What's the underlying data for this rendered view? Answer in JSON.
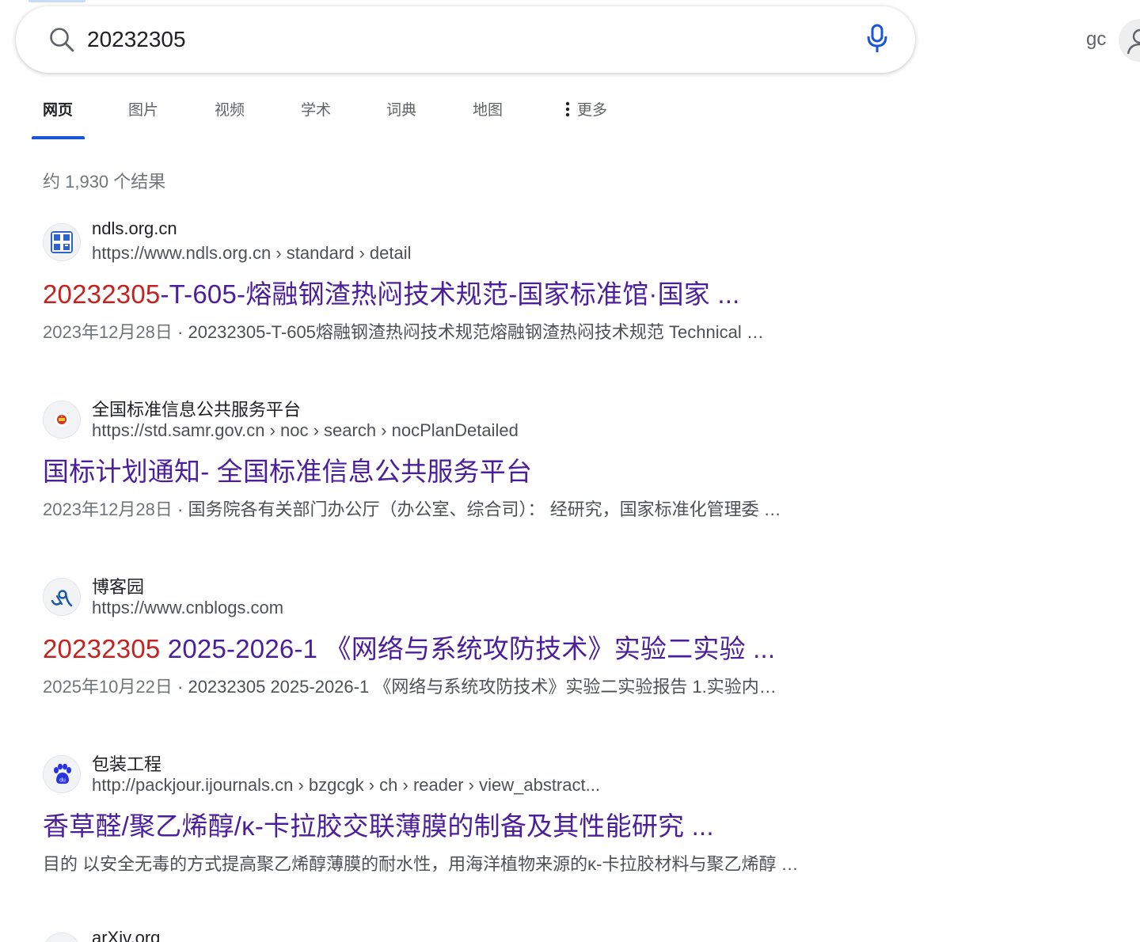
{
  "search": {
    "query": "20232305"
  },
  "header": {
    "user_text": "gc"
  },
  "tabs": [
    {
      "label": "网页"
    },
    {
      "label": "图片"
    },
    {
      "label": "视频"
    },
    {
      "label": "学术"
    },
    {
      "label": "词典"
    },
    {
      "label": "地图"
    },
    {
      "label": "更多"
    }
  ],
  "result_count": "约 1,930 个结果",
  "results": [
    {
      "site_name": "ndls.org.cn",
      "url": "https://www.ndls.org.cn › standard › detail",
      "title_highlight": "20232305",
      "title_rest": "-T-605-熔融钢渣热闷技术规范-国家标准馆·国家 ...",
      "date": "2023年12月28日",
      "snippet": "20232305-T-605熔融钢渣热闷技术规范熔融钢渣热闷技术规范 Technical …"
    },
    {
      "site_name": "全国标准信息公共服务平台",
      "url": "https://std.samr.gov.cn › noc › search › nocPlanDetailed",
      "title_highlight": "",
      "title_rest": "国标计划通知- 全国标准信息公共服务平台",
      "date": "2023年12月28日",
      "snippet": "国务院各有关部门办公厅（办公室、综合司）： 经研究，国家标准化管理委 …"
    },
    {
      "site_name": "博客园",
      "url": "https://www.cnblogs.com",
      "title_highlight": "20232305",
      "title_rest": " 2025-2026-1 《网络与系统攻防技术》实验二实验 ...",
      "date": "2025年10月22日",
      "snippet": "20232305 2025-2026-1 《网络与系统攻防技术》实验二实验报告 1.实验内…"
    },
    {
      "site_name": "包装工程",
      "url": "http://packjour.ijournals.cn › bzgcgk › ch › reader › view_abstract...",
      "title_highlight": "",
      "title_rest": "香草醛/聚乙烯醇/κ-卡拉胶交联薄膜的制备及其性能研究 ...",
      "date": "",
      "snippet": "目的 以安全无毒的方式提高聚乙烯醇薄膜的耐水性，用海洋植物来源的κ-卡拉胶材料与聚乙烯醇 …"
    },
    {
      "site_name": "arXiv.org"
    }
  ],
  "favicon_labels": {
    "baidu": "du"
  },
  "colors": {
    "accent": "#1a56db",
    "visited_title": "#4b1e9c",
    "highlight_red": "#c5221f"
  }
}
